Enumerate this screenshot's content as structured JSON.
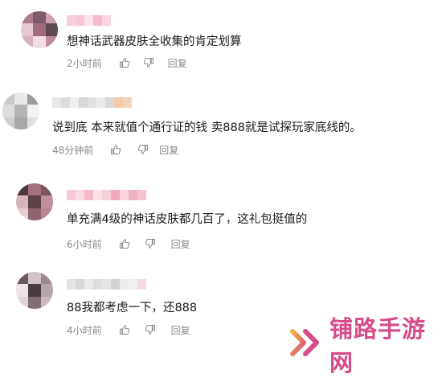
{
  "comments": [
    {
      "text": "想神话武器皮肤全收集的肯定划算",
      "time": "2小时前",
      "reply_label": "回复",
      "name_colors": [
        "#f5d0dd",
        "#f7c5d5",
        "#fde3ea",
        "#f3b9cc",
        "#fbd6e0"
      ],
      "avatar_colors": [
        "#b17a8f",
        "#7c5b6a",
        "#cfa2b3",
        "#e7c8d2",
        "#a36a80",
        "#5d4a53",
        "#d8b4c1",
        "#f0e0e6",
        "#c18aa0"
      ]
    },
    {
      "text": "说到底 本来就值个通行证的钱 卖888就是试探玩家底线的。",
      "time": "48分钟前",
      "reply_label": "回复",
      "name_colors": [
        "#e8e8e8",
        "#dcdcdc",
        "#efefef",
        "#d6d6d6",
        "#e2e2e2",
        "#ececec",
        "#d9d9d9",
        "#f4c9a9",
        "#f6d3b8"
      ],
      "avatar_colors": [
        "#c8c8c8",
        "#e9e9e9",
        "#9b9b9b",
        "#dedede",
        "#b3b3b3",
        "#f2f2f2",
        "#cfcfcf",
        "#a8a8a8",
        "#e0e0e0"
      ]
    },
    {
      "text": "单充满4级的神话皮肤都几百了，这礼包挺值的",
      "time": "6小时前",
      "reply_label": "回复",
      "name_colors": [
        "#f6c9d6",
        "#f9d9e2",
        "#f4b8c8",
        "#fbe2e9",
        "#f7cfd9",
        "#f2aabd",
        "#f9d4de",
        "#f3b2c4",
        "#f8c3d0"
      ],
      "avatar_colors": [
        "#4d3a3f",
        "#a66f7d",
        "#7d5560",
        "#d7b5bd",
        "#5a4247",
        "#c48e9b",
        "#e8cdd3",
        "#8d6470",
        "#b98491"
      ]
    },
    {
      "text": "88我都考虑一下，还888",
      "time": "4小时前",
      "reply_label": "回复",
      "name_colors": [
        "#e4e4e4",
        "#d8d8d8",
        "#ebebeb",
        "#dedede",
        "#e6e6e6",
        "#d2d2d2",
        "#ececec",
        "#f0f0f0",
        "#f8dbe3"
      ],
      "avatar_colors": [
        "#6b5a60",
        "#d0c4c8",
        "#9c8990",
        "#ece4e7",
        "#4a3d42",
        "#b8a6ad",
        "#e0d6da",
        "#806e75",
        "#c9b9bf"
      ]
    }
  ],
  "brand": {
    "name": "铺路手游网",
    "color": "#d64c8a"
  }
}
